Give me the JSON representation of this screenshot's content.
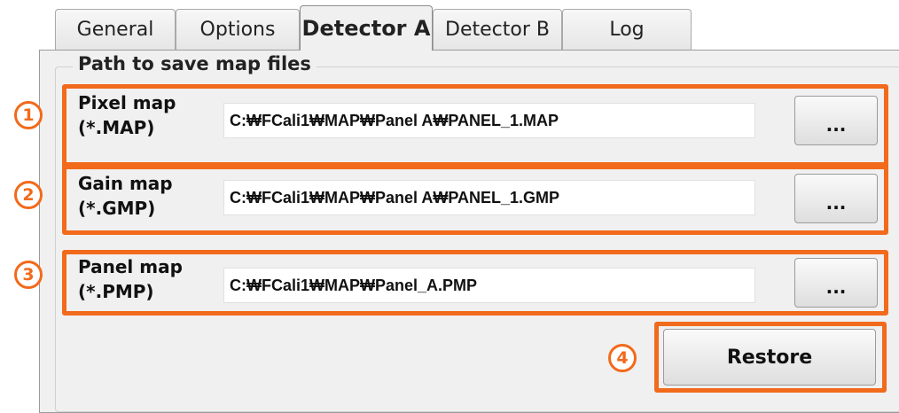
{
  "tabs": [
    {
      "label": "General",
      "active": false
    },
    {
      "label": "Options",
      "active": false
    },
    {
      "label": "Detector A",
      "active": true
    },
    {
      "label": "Detector B",
      "active": false
    },
    {
      "label": "Log",
      "active": false
    }
  ],
  "group_title": "Path to save map files",
  "rows": [
    {
      "marker": "1",
      "label_line1": "Pixel map",
      "label_line2": "(*.MAP)",
      "path": "C:₩FCali1₩MAP₩Panel A₩PANEL_1.MAP",
      "browse_label": "..."
    },
    {
      "marker": "2",
      "label_line1": "Gain map",
      "label_line2": "(*.GMP)",
      "path": "C:₩FCali1₩MAP₩Panel A₩PANEL_1.GMP",
      "browse_label": "..."
    },
    {
      "marker": "3",
      "label_line1": "Panel map",
      "label_line2": "(*.PMP)",
      "path": "C:₩FCali1₩MAP₩Panel_A.PMP",
      "browse_label": "..."
    }
  ],
  "restore": {
    "marker": "4",
    "label": "Restore"
  },
  "colors": {
    "highlight": "#f26a1b"
  }
}
